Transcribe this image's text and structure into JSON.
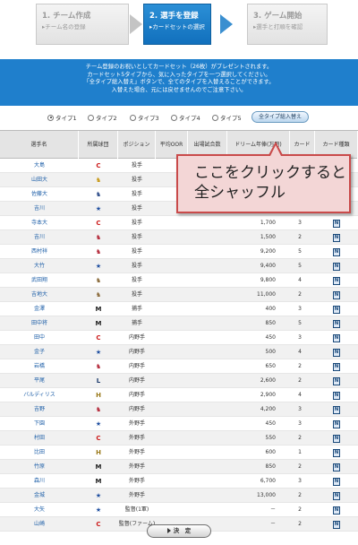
{
  "steps": [
    {
      "title": "1. チーム作成",
      "sub": "▸チーム名の登録"
    },
    {
      "title": "2. 選手を登録",
      "sub": "▸カードセットの選択"
    },
    {
      "title": "3. ゲーム開始",
      "sub": "▸選手と打順を確認"
    }
  ],
  "banner": {
    "line1": "チーム登録のお祝いとしてカードセット（26枚）がプレゼントされます。",
    "line2": "カードセット5タイプから、気に入ったタイプを一つ選択してください。",
    "line3": "「全タイプ総入替え」ボタンで、全てのタイプを入替えることができます。",
    "line4": "入替えた場合、元には戻せませんのでご注意下さい。"
  },
  "types": {
    "t1": "タイプ1",
    "t2": "タイプ2",
    "t3": "タイプ3",
    "t4": "タイプ4",
    "t5": "タイプ5",
    "selected": "タイプ1",
    "shuffle_all": "全タイプ総入替え"
  },
  "table": {
    "headers": {
      "name": "選手名",
      "team": "所属球団",
      "position": "ポジション",
      "avg": "平均OOR",
      "games": "出場試合数",
      "salary": "ドリーム年俸(万円)",
      "card": "カード",
      "cardtype": "カード種類"
    },
    "rows": [
      {
        "name": "大島",
        "team_icon": "C",
        "team_color": "#cc1a1a",
        "pos": "投手",
        "salary": "",
        "card": ""
      },
      {
        "name": "山田大",
        "team_icon": "♞",
        "team_color": "#c89a18",
        "pos": "投手",
        "salary": "",
        "card": ""
      },
      {
        "name": "佐藤大",
        "team_icon": "♞",
        "team_color": "#2e4d8a",
        "pos": "投手",
        "salary": "",
        "card": ""
      },
      {
        "name": "吉川",
        "team_icon": "★",
        "team_color": "#1f4fa0",
        "pos": "投手",
        "salary": "500",
        "card": "1"
      },
      {
        "name": "寺本大",
        "team_icon": "C",
        "team_color": "#cc1a1a",
        "pos": "投手",
        "salary": "1,700",
        "card": "3"
      },
      {
        "name": "吉川",
        "team_icon": "♞",
        "team_color": "#b4293a",
        "pos": "投手",
        "salary": "1,500",
        "card": "2"
      },
      {
        "name": "西村祥",
        "team_icon": "♞",
        "team_color": "#b4293a",
        "pos": "投手",
        "salary": "9,200",
        "card": "5"
      },
      {
        "name": "大竹",
        "team_icon": "★",
        "team_color": "#1f4fa0",
        "pos": "投手",
        "salary": "9,400",
        "card": "5"
      },
      {
        "name": "武田翔",
        "team_icon": "♞",
        "team_color": "#8a6a3a",
        "pos": "投手",
        "salary": "9,800",
        "card": "4"
      },
      {
        "name": "吉地大",
        "team_icon": "♞",
        "team_color": "#8a6a3a",
        "pos": "投手",
        "salary": "11,000",
        "card": "2"
      },
      {
        "name": "金澤",
        "team_icon": "M",
        "team_color": "#222222",
        "pos": "捕手",
        "salary": "400",
        "card": "3"
      },
      {
        "name": "田中将",
        "team_icon": "M",
        "team_color": "#222222",
        "pos": "捕手",
        "salary": "850",
        "card": "5"
      },
      {
        "name": "田中",
        "team_icon": "C",
        "team_color": "#cc1a1a",
        "pos": "内野手",
        "salary": "450",
        "card": "3"
      },
      {
        "name": "金子",
        "team_icon": "★",
        "team_color": "#1f4fa0",
        "pos": "内野手",
        "salary": "500",
        "card": "4"
      },
      {
        "name": "岩橋",
        "team_icon": "♞",
        "team_color": "#b4293a",
        "pos": "内野手",
        "salary": "650",
        "card": "2"
      },
      {
        "name": "平尾",
        "team_icon": "L",
        "team_color": "#1b3a6b",
        "pos": "内野手",
        "salary": "2,600",
        "card": "2"
      },
      {
        "name": "バルディリス",
        "team_icon": "H",
        "team_color": "#9a7a1a",
        "pos": "内野手",
        "salary": "2,900",
        "card": "4"
      },
      {
        "name": "吉野",
        "team_icon": "♞",
        "team_color": "#b4293a",
        "pos": "内野手",
        "salary": "4,200",
        "card": "3"
      },
      {
        "name": "下園",
        "team_icon": "★",
        "team_color": "#1f4fa0",
        "pos": "外野手",
        "salary": "450",
        "card": "3"
      },
      {
        "name": "村田",
        "team_icon": "C",
        "team_color": "#cc1a1a",
        "pos": "外野手",
        "salary": "550",
        "card": "2"
      },
      {
        "name": "比田",
        "team_icon": "H",
        "team_color": "#9a7a1a",
        "pos": "外野手",
        "salary": "600",
        "card": "1"
      },
      {
        "name": "竹原",
        "team_icon": "M",
        "team_color": "#222222",
        "pos": "外野手",
        "salary": "850",
        "card": "2"
      },
      {
        "name": "森川",
        "team_icon": "M",
        "team_color": "#222222",
        "pos": "外野手",
        "salary": "6,700",
        "card": "3"
      },
      {
        "name": "金城",
        "team_icon": "★",
        "team_color": "#1f4fa0",
        "pos": "外野手",
        "salary": "13,000",
        "card": "2"
      },
      {
        "name": "大矢",
        "team_icon": "★",
        "team_color": "#1f4fa0",
        "pos": "監督(1軍)",
        "salary": "－",
        "card": "2"
      },
      {
        "name": "山崎",
        "team_icon": "C",
        "team_color": "#cc1a1a",
        "pos": "監督(ファーム)",
        "salary": "－",
        "card": "2"
      }
    ],
    "card_icon": "N"
  },
  "callout": {
    "line1": "ここをクリックすると",
    "line2": "全シャッフル"
  },
  "decide_button": "決　定"
}
